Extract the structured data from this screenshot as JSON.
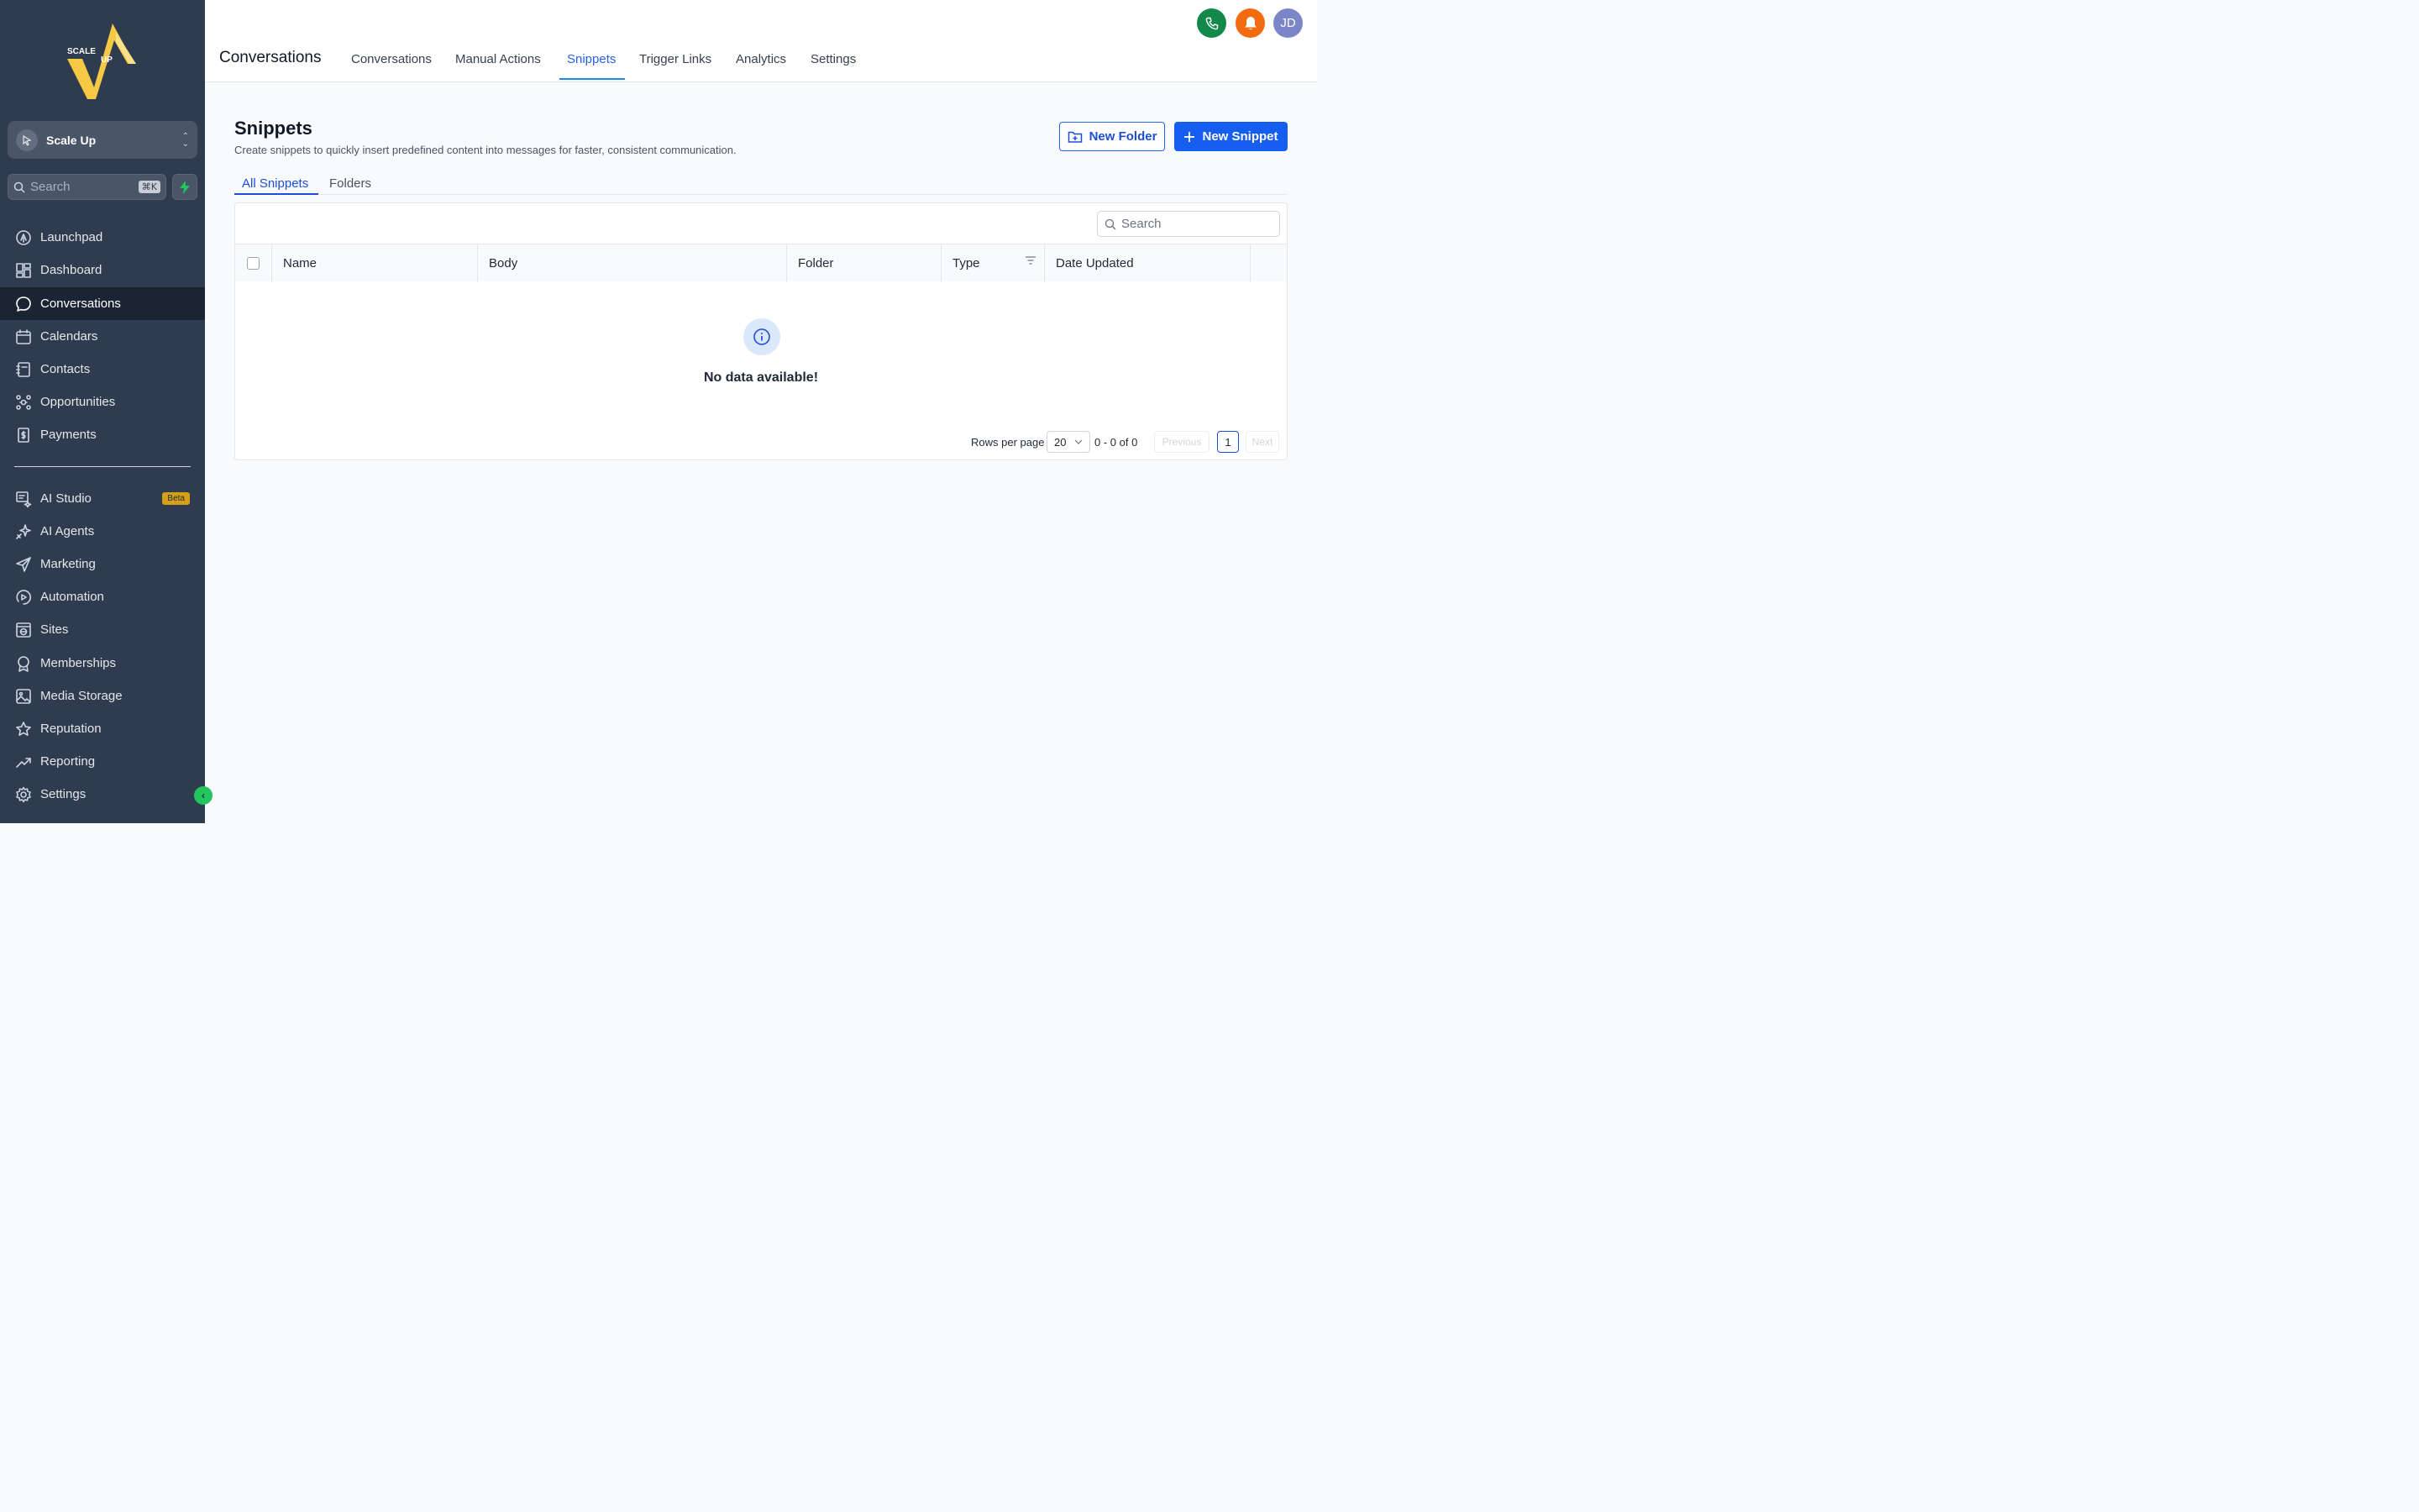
{
  "brand": {
    "logo_text_top": "SCALE",
    "logo_text_bottom": "UP"
  },
  "account": {
    "name": "Scale Up"
  },
  "sidebar_search": {
    "placeholder": "Search",
    "shortcut": "⌘K"
  },
  "sidebar": {
    "items_top": [
      {
        "label": "Launchpad",
        "icon": "rocket-icon"
      },
      {
        "label": "Dashboard",
        "icon": "dashboard-icon"
      },
      {
        "label": "Conversations",
        "icon": "chat-icon",
        "active": true
      },
      {
        "label": "Calendars",
        "icon": "calendar-icon"
      },
      {
        "label": "Contacts",
        "icon": "contacts-icon"
      },
      {
        "label": "Opportunities",
        "icon": "opportunities-icon"
      },
      {
        "label": "Payments",
        "icon": "payments-icon"
      }
    ],
    "items_bottom": [
      {
        "label": "AI Studio",
        "icon": "ai-studio-icon",
        "badge": "Beta"
      },
      {
        "label": "AI Agents",
        "icon": "sparkle-icon"
      },
      {
        "label": "Marketing",
        "icon": "send-icon"
      },
      {
        "label": "Automation",
        "icon": "automation-icon"
      },
      {
        "label": "Sites",
        "icon": "globe-icon"
      },
      {
        "label": "Memberships",
        "icon": "award-icon"
      },
      {
        "label": "Media Storage",
        "icon": "image-icon"
      },
      {
        "label": "Reputation",
        "icon": "star-icon"
      },
      {
        "label": "Reporting",
        "icon": "trend-icon"
      },
      {
        "label": "Settings",
        "icon": "gear-icon"
      }
    ]
  },
  "topbar": {
    "title": "Conversations",
    "tabs": [
      "Conversations",
      "Manual Actions",
      "Snippets",
      "Trigger Links",
      "Analytics",
      "Settings"
    ],
    "active_tab": "Snippets",
    "avatar_initials": "JD",
    "colors": {
      "phone": "#12884b",
      "bell": "#f26b0f",
      "avatar": "#7b86c8"
    }
  },
  "page": {
    "title": "Snippets",
    "subtitle": "Create snippets to quickly insert predefined content into messages for faster, consistent communication.",
    "new_folder_label": "New Folder",
    "new_snippet_label": "New Snippet",
    "subtabs": [
      "All Snippets",
      "Folders"
    ],
    "active_subtab": "All Snippets"
  },
  "table": {
    "search_placeholder": "Search",
    "columns": [
      "Name",
      "Body",
      "Folder",
      "Type",
      "Date Updated"
    ],
    "rows": [],
    "empty_text": "No data available!",
    "rows_per_page_label": "Rows per page",
    "rows_per_page_value": "20",
    "range_text": "0 - 0 of 0",
    "prev_label": "Previous",
    "next_label": "Next",
    "current_page": "1"
  }
}
